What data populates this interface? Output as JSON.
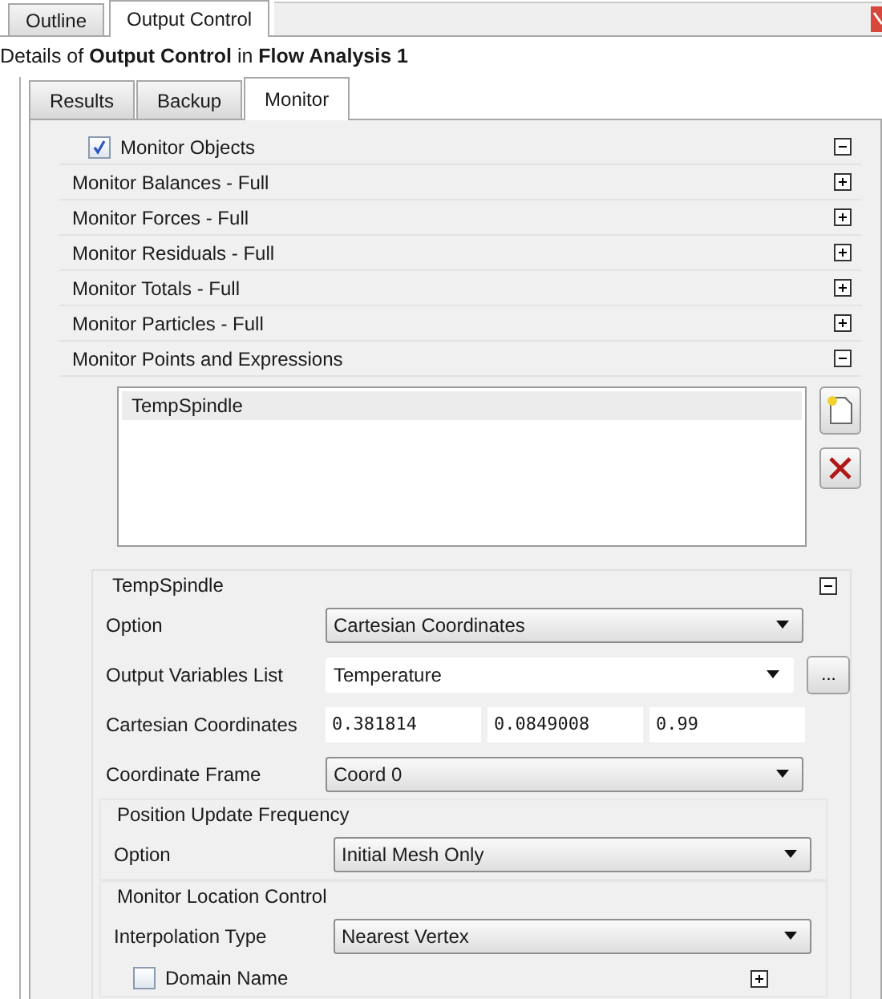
{
  "top_tabs": [
    {
      "label": "Outline",
      "selected": false
    },
    {
      "label": "Output Control",
      "selected": true
    }
  ],
  "details_heading": "Details of **Output Control** in **Flow Analysis 1**",
  "tabs": [
    {
      "label": "Results",
      "selected": false
    },
    {
      "label": "Backup",
      "selected": false
    },
    {
      "label": "Monitor",
      "selected": true
    }
  ],
  "monitor_objects": {
    "label": "Monitor Objects",
    "checked": true,
    "expanded": true
  },
  "sections": [
    {
      "label": "Monitor Balances - Full",
      "expanded": false
    },
    {
      "label": "Monitor Forces - Full",
      "expanded": false
    },
    {
      "label": "Monitor Residuals - Full",
      "expanded": false
    },
    {
      "label": "Monitor Totals - Full",
      "expanded": false
    },
    {
      "label": "Monitor Particles - Full",
      "expanded": false
    }
  ],
  "monitor_points": {
    "label": "Monitor Points and Expressions",
    "expanded": true,
    "list": [
      {
        "label": "TempSpindle",
        "selected": true
      }
    ],
    "detail": {
      "title": "TempSpindle",
      "expanded": true,
      "rows": [
        {
          "kind": "dropdown",
          "label": "Option",
          "value": "Cartesian Coordinates"
        },
        {
          "kind": "editable-dropdown",
          "label": "Output Variables List",
          "value": "Temperature",
          "button": "..."
        },
        {
          "kind": "coordinates",
          "label": "Cartesian Coordinates",
          "values": [
            "0.381814",
            "0.0849008",
            "0.99"
          ]
        },
        {
          "kind": "dropdown",
          "label": "Coordinate Frame",
          "value": "Coord 0"
        }
      ],
      "groups": [
        {
          "title": "Position Update Frequency",
          "rows": [
            {
              "kind": "dropdown",
              "label": "Option",
              "value": "Initial Mesh Only"
            }
          ]
        },
        {
          "title": "Monitor Location Control",
          "rows": [
            {
              "kind": "dropdown",
              "label": "Interpolation Type",
              "value": "Nearest Vertex"
            },
            {
              "kind": "checkbox",
              "label": "Domain Name",
              "checked": false,
              "expanded": false
            }
          ]
        }
      ]
    }
  }
}
